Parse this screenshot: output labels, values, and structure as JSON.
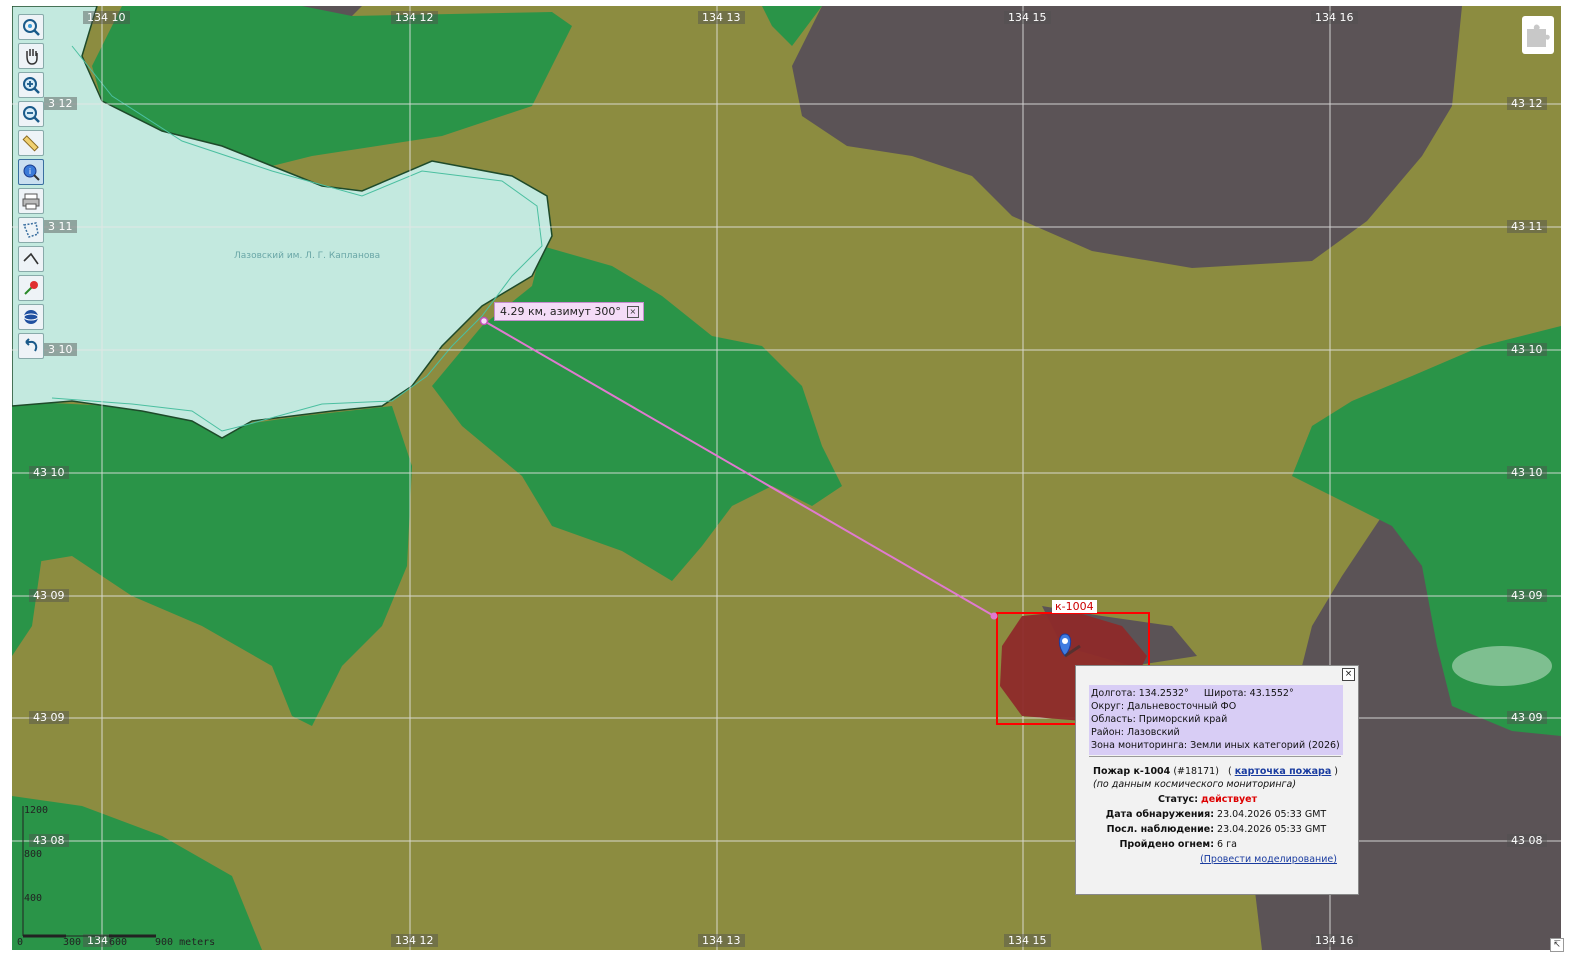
{
  "toolbar": {
    "tools": [
      {
        "name": "zoom-extent-icon"
      },
      {
        "name": "pan-hand-icon"
      },
      {
        "name": "zoom-in-icon"
      },
      {
        "name": "zoom-out-icon"
      },
      {
        "name": "ruler-icon"
      },
      {
        "name": "info-identify-icon"
      },
      {
        "name": "print-icon"
      },
      {
        "name": "select-polygon-icon"
      },
      {
        "name": "measure-line-icon"
      },
      {
        "name": "add-point-icon"
      },
      {
        "name": "globe-layers-icon"
      },
      {
        "name": "undo-icon"
      }
    ]
  },
  "grid": {
    "lon_labels": [
      "134 10",
      "134 12",
      "134 13",
      "134 15",
      "134 16"
    ],
    "lon_bottom_labels": [
      "134 12",
      "134 13",
      "134 15",
      "134 16"
    ],
    "lon_bottom_partial": "134",
    "lat_labels_left": [
      "43 12",
      "43 11",
      "43 10",
      "43 10",
      "43 09",
      "43 09",
      "43 08"
    ],
    "lat_labels_left_partial": [
      "3 12",
      "3 11",
      "3 10"
    ],
    "lat_labels_right": [
      "43 12",
      "43 11",
      "43 10",
      "43 10",
      "43 09",
      "43 09",
      "43 08"
    ]
  },
  "lake": {
    "label": "Лазовский им. Л. Г. Капланова"
  },
  "measurement": {
    "text": "4.29 км,  азимут 300°",
    "close": "×"
  },
  "fire": {
    "label": "к-1004"
  },
  "popup": {
    "close": "×",
    "longitude_label": "Долгота:",
    "longitude_value": "134.2532°",
    "latitude_label": "Широта:",
    "latitude_value": "43.1552°",
    "district_line": "Округ: Дальневосточный ФО",
    "region_line": "Область: Приморский край",
    "area_line": "Район: Лазовский",
    "zone_line": "Зона мониторинга: Земли иных категорий (2026)",
    "fire_title_bold": "Пожар к-1004",
    "fire_id": "(#18171)",
    "card_open": "(",
    "card_link": "карточка пожара",
    "card_close": ")",
    "source": "(по данным космического мониторинга)",
    "status_label": "Статус:",
    "status_value": "действует",
    "detected_label": "Дата обнаружения:",
    "detected_value": "23.04.2026 05:33 GMT",
    "last_obs_label": "Посл. наблюдение:",
    "last_obs_value": "23.04.2026 05:33 GMT",
    "burned_label": "Пройдено огнем:",
    "burned_value": "6 га",
    "model_link": "(Провести моделирование)"
  },
  "scale": {
    "v_labels": [
      "1200",
      "800",
      "400",
      "0"
    ],
    "h_labels": [
      "300",
      "600",
      "900 meters"
    ]
  },
  "colors": {
    "olive": "#8c8c40",
    "forest": "#2a9448",
    "dark": "#5b5356",
    "lake": "#c3e9df",
    "fire_fill": "#8e2a2a",
    "fire_box": "#ff0000",
    "measure_line": "#e07ad0"
  },
  "plugin": {
    "icon": "puzzle-icon"
  },
  "corner": {
    "label": "↸"
  }
}
